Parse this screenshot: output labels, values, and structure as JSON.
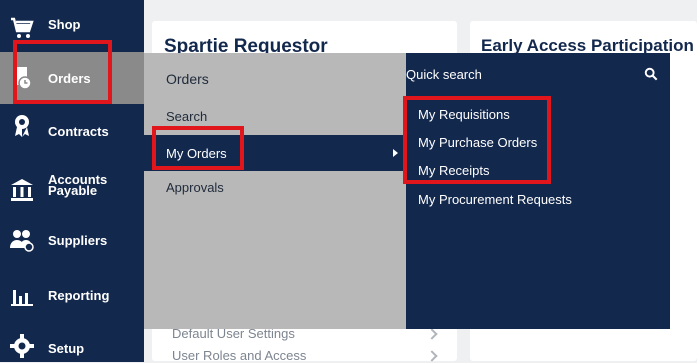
{
  "sidebar": {
    "items": [
      {
        "label": "Shop",
        "icon": "cart-icon"
      },
      {
        "label": "Orders",
        "icon": "orders-icon"
      },
      {
        "label": "Contracts",
        "icon": "ribbon-icon"
      },
      {
        "label": "Accounts\nPayable",
        "icon": "bank-icon"
      },
      {
        "label": "Suppliers",
        "icon": "suppliers-icon"
      },
      {
        "label": "Reporting",
        "icon": "bar-chart-icon"
      },
      {
        "label": "Setup",
        "icon": "gear-icon"
      }
    ]
  },
  "cards": {
    "left_title": "Spartie Requestor",
    "right_title": "Early Access Participation"
  },
  "orders_menu": {
    "title": "Orders",
    "items": [
      "Search",
      "My Orders",
      "Approvals"
    ]
  },
  "submenu": {
    "quick_search": "Quick search",
    "items": [
      "My Requisitions",
      "My Purchase Orders",
      "My Receipts",
      "My Procurement Requests"
    ]
  },
  "background_list": [
    "Default User Settings",
    "User Roles and Access"
  ],
  "colors": {
    "navy": "#13284d",
    "highlight": "#e0161c",
    "menu_gray": "#b8b8b8"
  }
}
